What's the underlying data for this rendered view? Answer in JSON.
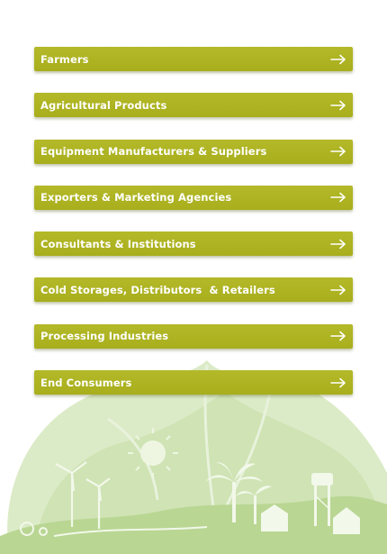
{
  "menu": {
    "items": [
      {
        "label": "Farmers",
        "icon": "arrow-right-icon"
      },
      {
        "label": "Agricultural Products",
        "icon": "arrow-right-icon"
      },
      {
        "label": "Equipment Manufacturers & Suppliers",
        "icon": "arrow-right-icon"
      },
      {
        "label": "Exporters & Marketing Agencies",
        "icon": "arrow-right-icon"
      },
      {
        "label": "Consultants & Institutions",
        "icon": "arrow-right-icon"
      },
      {
        "label": "Cold Storages, Distributors  & Retailers",
        "icon": "arrow-right-icon"
      },
      {
        "label": "Processing Industries",
        "icon": "arrow-right-icon"
      },
      {
        "label": "End Consumers",
        "icon": "arrow-right-icon"
      }
    ]
  },
  "colors": {
    "button_bg": "#aab21f",
    "button_text": "#ffffff",
    "illustration_green": "#c7dfa6"
  }
}
